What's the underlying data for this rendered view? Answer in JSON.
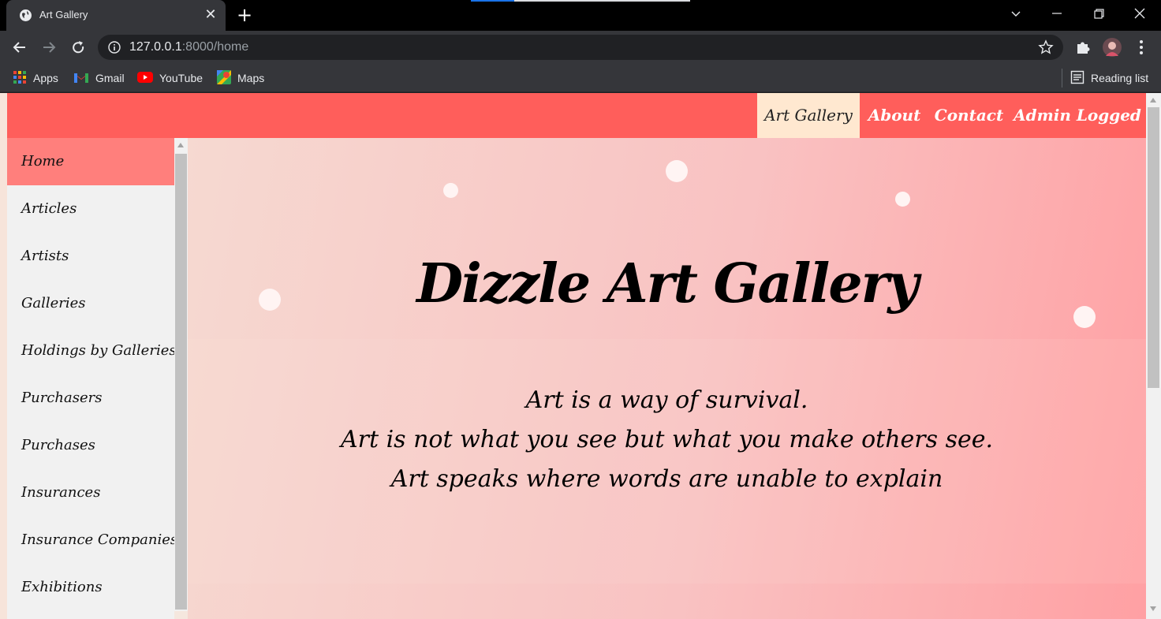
{
  "browser": {
    "tab_title": "Art Gallery",
    "tab_close": "✕",
    "new_tab": "+",
    "url_host": "127.0.0.1",
    "url_rest": ":8000/home",
    "bookmarks": [
      {
        "label": "Apps",
        "icon": "apps-grid-icon"
      },
      {
        "label": "Gmail",
        "icon": "gmail-icon"
      },
      {
        "label": "YouTube",
        "icon": "youtube-icon"
      },
      {
        "label": "Maps",
        "icon": "maps-icon"
      }
    ],
    "reading_list": "Reading list"
  },
  "nav": {
    "brand": "Art Gallery",
    "about": "About",
    "contact": "Contact",
    "admin": "Admin Logged In"
  },
  "sidebar": {
    "items": [
      {
        "label": "Home"
      },
      {
        "label": "Articles"
      },
      {
        "label": "Artists"
      },
      {
        "label": "Galleries"
      },
      {
        "label": "Holdings by Galleries"
      },
      {
        "label": "Purchasers"
      },
      {
        "label": "Purchases"
      },
      {
        "label": "Insurances"
      },
      {
        "label": "Insurance Companies"
      },
      {
        "label": "Exhibitions"
      }
    ]
  },
  "hero": {
    "title": "Dizzle Art Gallery",
    "quotes": [
      "Art is a way of survival.",
      "Art is not what you see but what you make others see.",
      "Art speaks where words are unable to explain"
    ]
  },
  "colors": {
    "nav_bg": "#ff5e5b",
    "nav_active_bg": "#ffe8d0",
    "sidebar_active_bg": "#ff7f7c",
    "hero_gradient_start": "#f6d9d1",
    "hero_gradient_end": "#ffa0a3"
  }
}
